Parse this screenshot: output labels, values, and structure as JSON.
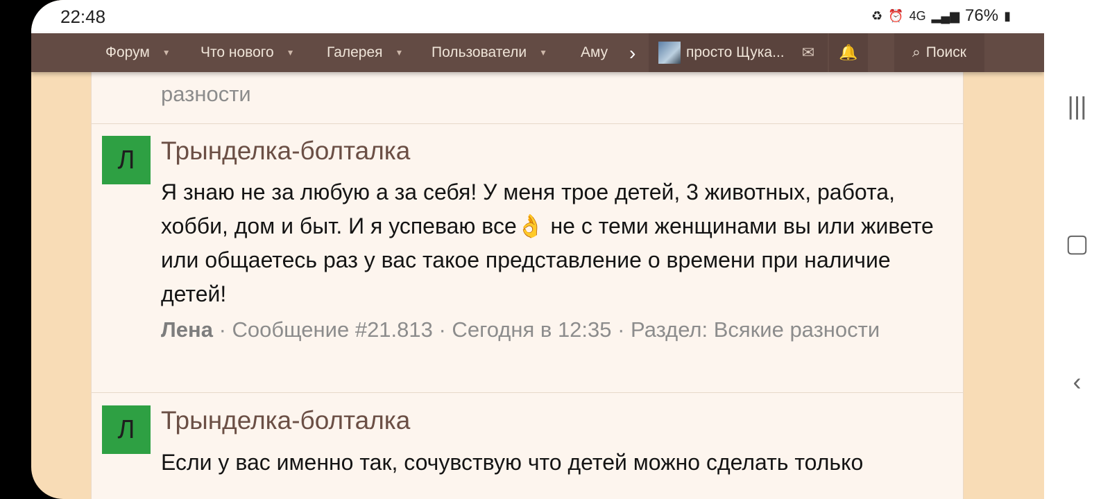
{
  "status": {
    "time": "22:48",
    "battery": "76%",
    "network": "4G"
  },
  "nav": {
    "items": [
      "Форум",
      "Что нового",
      "Галерея",
      "Пользователи",
      "Аму"
    ],
    "user_name": "просто Щука...",
    "search_label": "Поиск"
  },
  "posts": [
    {
      "meta_tail": "разности"
    },
    {
      "avatar_letter": "Л",
      "title": "Трынделка-болталка",
      "body": "Я знаю не за любую а за себя! У меня трое детей, 3 животных, работа, хобби, дом и быт. И я успеваю все👌 не с теми женщинами вы или живете или общаетесь раз у вас такое представление о времени при наличие детей!",
      "author": "Лена",
      "meta": " · Сообщение #21.813 · Сегодня в 12:35 · Раздел: Всякие разности"
    },
    {
      "avatar_letter": "Л",
      "title": "Трынделка-болталка",
      "body": "Если у вас именно так, сочувствую что детей можно сделать только"
    }
  ],
  "colors": {
    "nav_bg": "#634b44",
    "page_bg": "#f8dcb6",
    "avatar_green": "#2ea043",
    "title_brown": "#6b4f45"
  }
}
